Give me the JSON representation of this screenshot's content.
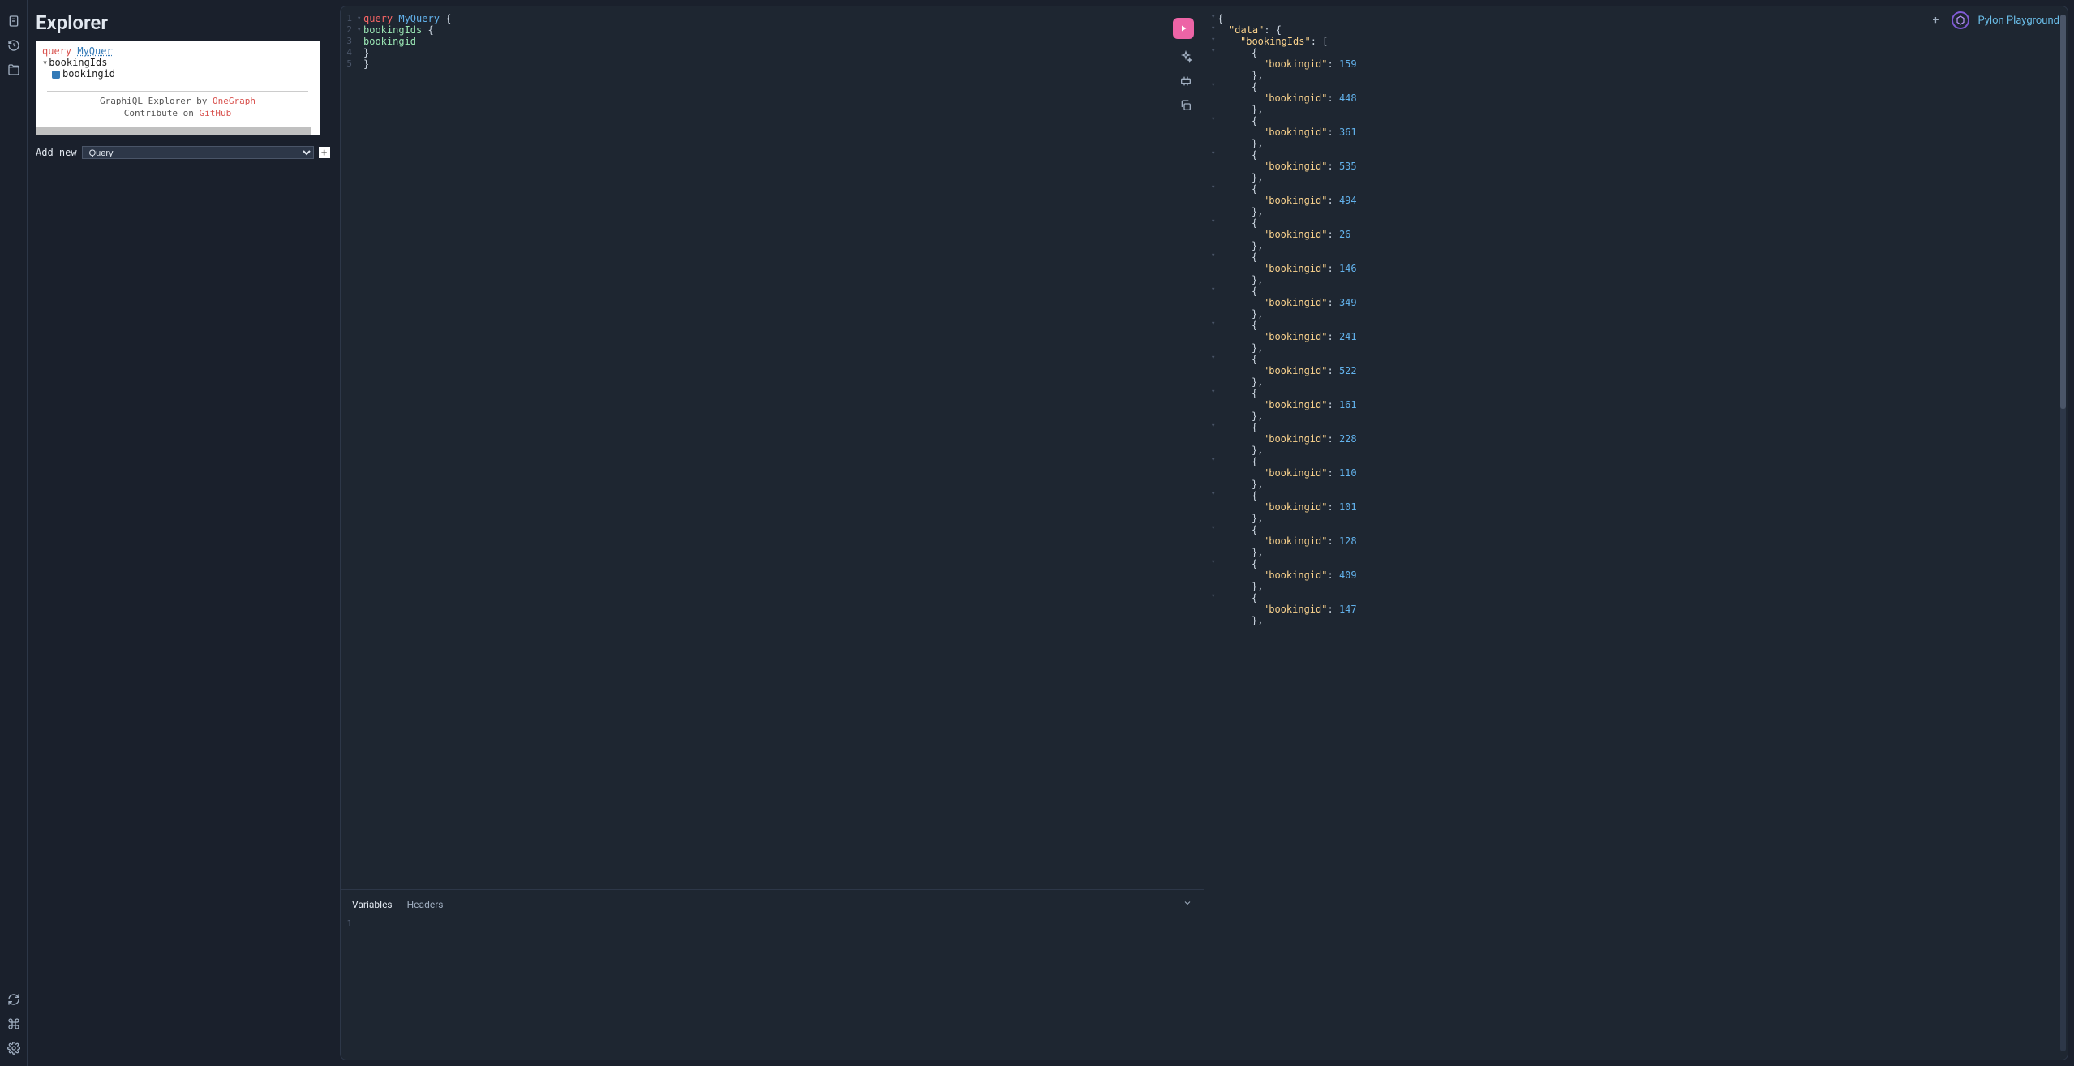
{
  "brand": "Pylon Playground",
  "explorer": {
    "title": "Explorer",
    "query_kw": "query",
    "query_name": "MyQuer",
    "root_field": "bookingIds",
    "sub_field": "bookingid",
    "footer_prefix": "GraphiQL Explorer by ",
    "footer_link1": "OneGraph",
    "footer_line2_prefix": "Contribute on ",
    "footer_link2": "GitHub",
    "add_new_label": "Add new",
    "add_new_option": "Query"
  },
  "query": {
    "lines": [
      {
        "n": "1",
        "fold": "▾",
        "tokens": [
          {
            "t": "query ",
            "c": "tok-kw"
          },
          {
            "t": "MyQuery ",
            "c": "tok-type"
          },
          {
            "t": "{",
            "c": "tok-punc"
          }
        ]
      },
      {
        "n": "2",
        "fold": "▾",
        "tokens": [
          {
            "t": "  bookingIds ",
            "c": "tok-prop"
          },
          {
            "t": "{",
            "c": "tok-punc"
          }
        ]
      },
      {
        "n": "3",
        "fold": "",
        "tokens": [
          {
            "t": "    bookingid",
            "c": "tok-prop"
          }
        ]
      },
      {
        "n": "4",
        "fold": "",
        "tokens": [
          {
            "t": "  }",
            "c": "tok-punc"
          }
        ]
      },
      {
        "n": "5",
        "fold": "",
        "tokens": [
          {
            "t": "}",
            "c": "tok-punc"
          }
        ]
      }
    ]
  },
  "vars": {
    "tab1": "Variables",
    "tab2": "Headers",
    "line_no": "1"
  },
  "response": {
    "data_key": "\"data\"",
    "list_key": "\"bookingIds\"",
    "item_key": "\"bookingid\"",
    "items": [
      159,
      448,
      361,
      535,
      494,
      26,
      146,
      349,
      241,
      522,
      161,
      228,
      110,
      101,
      128,
      409,
      147
    ]
  }
}
